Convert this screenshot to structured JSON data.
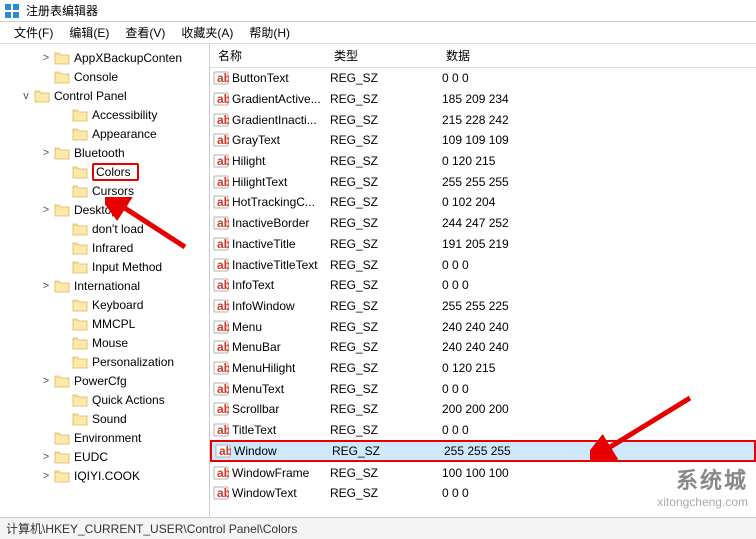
{
  "title": "注册表编辑器",
  "menu": {
    "file": "文件(F)",
    "edit": "编辑(E)",
    "view": "查看(V)",
    "favorites": "收藏夹(A)",
    "help": "帮助(H)"
  },
  "tree": [
    {
      "indent": 38,
      "exp": ">",
      "label": "AppXBackupConten"
    },
    {
      "indent": 38,
      "exp": "",
      "label": "Console"
    },
    {
      "indent": 18,
      "exp": "v",
      "label": "Control Panel"
    },
    {
      "indent": 56,
      "exp": "",
      "label": "Accessibility"
    },
    {
      "indent": 56,
      "exp": "",
      "label": "Appearance"
    },
    {
      "indent": 38,
      "exp": ">",
      "label": "Bluetooth"
    },
    {
      "indent": 56,
      "exp": "",
      "label": "Colors",
      "selected": true
    },
    {
      "indent": 56,
      "exp": "",
      "label": "Cursors"
    },
    {
      "indent": 38,
      "exp": ">",
      "label": "Desktop"
    },
    {
      "indent": 56,
      "exp": "",
      "label": "don't load"
    },
    {
      "indent": 56,
      "exp": "",
      "label": "Infrared"
    },
    {
      "indent": 56,
      "exp": "",
      "label": "Input Method"
    },
    {
      "indent": 38,
      "exp": ">",
      "label": "International"
    },
    {
      "indent": 56,
      "exp": "",
      "label": "Keyboard"
    },
    {
      "indent": 56,
      "exp": "",
      "label": "MMCPL"
    },
    {
      "indent": 56,
      "exp": "",
      "label": "Mouse"
    },
    {
      "indent": 56,
      "exp": "",
      "label": "Personalization"
    },
    {
      "indent": 38,
      "exp": ">",
      "label": "PowerCfg"
    },
    {
      "indent": 56,
      "exp": "",
      "label": "Quick Actions"
    },
    {
      "indent": 56,
      "exp": "",
      "label": "Sound"
    },
    {
      "indent": 38,
      "exp": "",
      "label": "Environment"
    },
    {
      "indent": 38,
      "exp": ">",
      "label": "EUDC"
    },
    {
      "indent": 38,
      "exp": ">",
      "label": "IQIYI.COOK"
    }
  ],
  "columns": {
    "name": "名称",
    "type": "类型",
    "data": "数据"
  },
  "values": [
    {
      "name": "ButtonText",
      "type": "REG_SZ",
      "data": "0 0 0"
    },
    {
      "name": "GradientActive...",
      "type": "REG_SZ",
      "data": "185 209 234"
    },
    {
      "name": "GradientInacti...",
      "type": "REG_SZ",
      "data": "215 228 242"
    },
    {
      "name": "GrayText",
      "type": "REG_SZ",
      "data": "109 109 109"
    },
    {
      "name": "Hilight",
      "type": "REG_SZ",
      "data": "0 120 215"
    },
    {
      "name": "HilightText",
      "type": "REG_SZ",
      "data": "255 255 255"
    },
    {
      "name": "HotTrackingC...",
      "type": "REG_SZ",
      "data": "0 102 204"
    },
    {
      "name": "InactiveBorder",
      "type": "REG_SZ",
      "data": "244 247 252"
    },
    {
      "name": "InactiveTitle",
      "type": "REG_SZ",
      "data": "191 205 219"
    },
    {
      "name": "InactiveTitleText",
      "type": "REG_SZ",
      "data": "0 0 0"
    },
    {
      "name": "InfoText",
      "type": "REG_SZ",
      "data": "0 0 0"
    },
    {
      "name": "InfoWindow",
      "type": "REG_SZ",
      "data": "255 255 225"
    },
    {
      "name": "Menu",
      "type": "REG_SZ",
      "data": "240 240 240"
    },
    {
      "name": "MenuBar",
      "type": "REG_SZ",
      "data": "240 240 240"
    },
    {
      "name": "MenuHilight",
      "type": "REG_SZ",
      "data": "0 120 215"
    },
    {
      "name": "MenuText",
      "type": "REG_SZ",
      "data": "0 0 0"
    },
    {
      "name": "Scrollbar",
      "type": "REG_SZ",
      "data": "200 200 200"
    },
    {
      "name": "TitleText",
      "type": "REG_SZ",
      "data": "0 0 0"
    },
    {
      "name": "Window",
      "type": "REG_SZ",
      "data": "255 255 255",
      "selected": true
    },
    {
      "name": "WindowFrame",
      "type": "REG_SZ",
      "data": "100 100 100"
    },
    {
      "name": "WindowText",
      "type": "REG_SZ",
      "data": "0 0 0"
    }
  ],
  "status_path": "计算机\\HKEY_CURRENT_USER\\Control Panel\\Colors",
  "watermark": {
    "brand": "系统城",
    "url": "xitongcheng.com"
  }
}
